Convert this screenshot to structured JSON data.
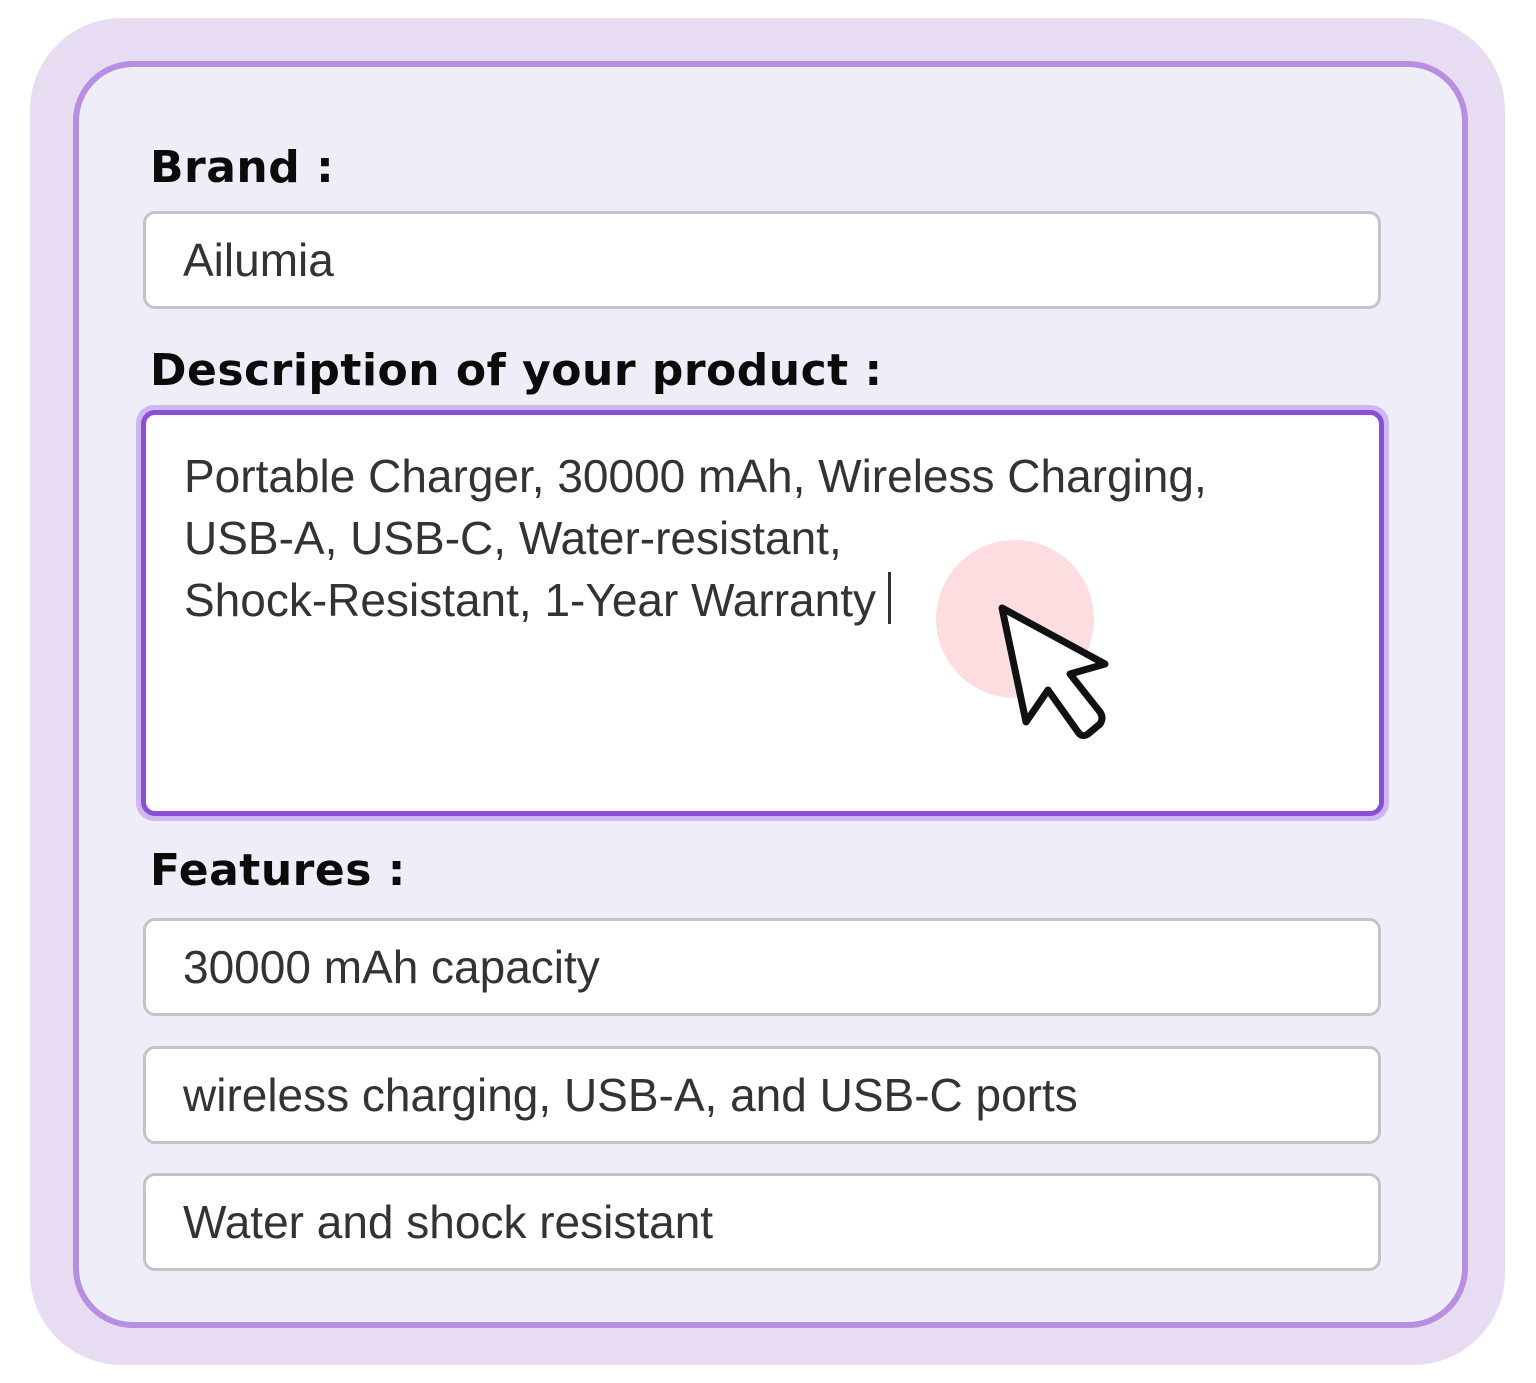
{
  "brand": {
    "label": "Brand :",
    "value": "Ailumia"
  },
  "description": {
    "label": "Description of your product :",
    "lines": [
      "Portable Charger, 30000 mAh, Wireless Charging,",
      "USB-A, USB-C, Water-resistant,",
      "Shock-Resistant, 1-Year Warranty"
    ]
  },
  "features": {
    "label": "Features :",
    "items": [
      "30000 mAh capacity",
      "wireless charging, USB-A, and USB-C ports",
      "Water and shock resistant"
    ]
  },
  "pointer": {
    "icon": "arrow-cursor-icon",
    "click_highlight_color": "#fcd2d6"
  },
  "colors": {
    "accent": "#8a4fd6",
    "card_border": "#b88ee0",
    "outer_bg": "#e7dcf2",
    "card_bg": "#efedf7"
  }
}
